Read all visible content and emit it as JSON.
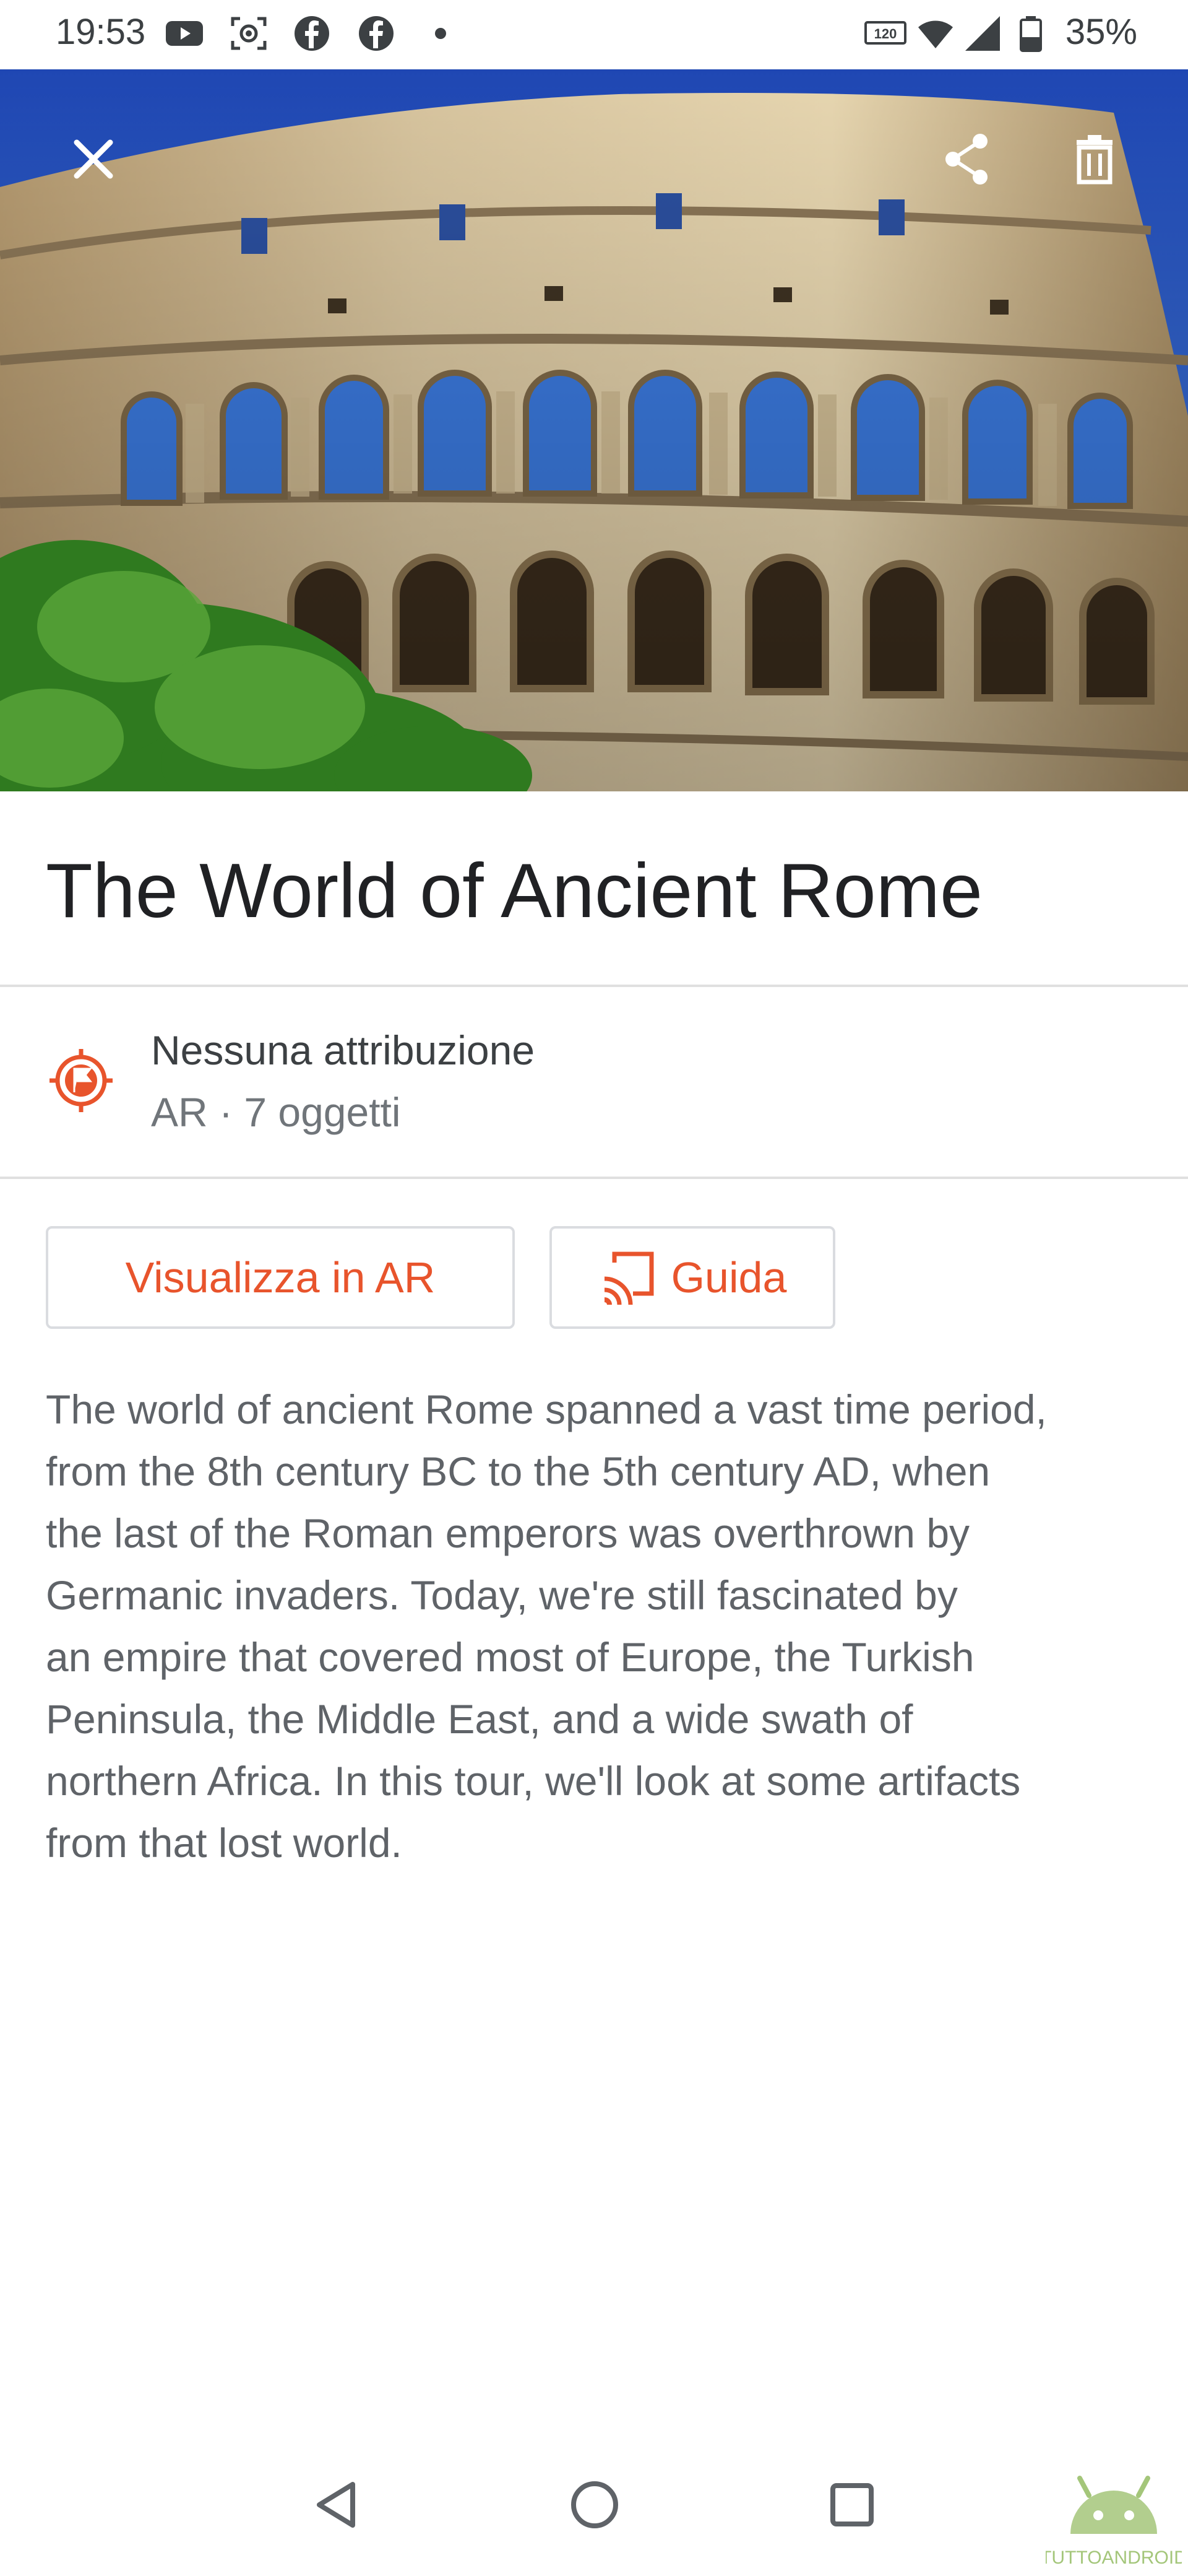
{
  "status_bar": {
    "time": "19:53",
    "battery": "35%",
    "icons": [
      "youtube-icon",
      "screen-record-icon",
      "facebook-icon",
      "facebook-icon",
      "dot-icon",
      "hd-icon",
      "wifi-icon",
      "signal-icon",
      "battery-icon"
    ]
  },
  "hero": {
    "image": "colosseum-photo",
    "actions": [
      "close-icon",
      "share-icon",
      "trash-icon"
    ]
  },
  "title": "The World of Ancient Rome",
  "attribution": {
    "icon": "flag-marker-icon",
    "title": "Nessuna attribuzione",
    "subtitle": "AR · 7 oggetti"
  },
  "buttons": {
    "view_ar": "Visualizza in AR",
    "guide": "Guida"
  },
  "description": "The world of ancient Rome spanned a vast time period,\nfrom the 8th century BC to the 5th century AD, when\nthe last of the Roman emperors was overthrown by\nGermanic invaders. Today, we're still fascinated by\nan empire that covered most of Europe, the Turkish\nPeninsula, the Middle East, and a wide swath of\nnorthern Africa. In this tour, we'll look at some artifacts\nfrom that lost world.",
  "nav": [
    "back-icon",
    "home-icon",
    "recents-icon"
  ],
  "watermark": "TUTTOANDROID",
  "colors": {
    "accent": "#e8542c",
    "sky": "#2f5ec4",
    "stone": "#c9ad7e"
  }
}
